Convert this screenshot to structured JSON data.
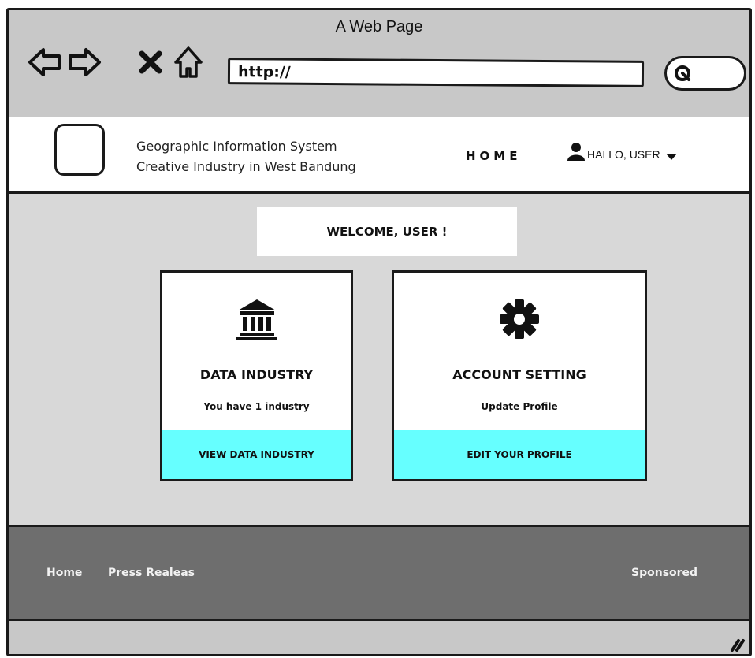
{
  "window": {
    "title": "A Web Page"
  },
  "browser": {
    "icons": [
      "back-arrow-icon",
      "forward-arrow-icon",
      "close-x-icon",
      "home-icon",
      "search-icon"
    ],
    "url": "http://"
  },
  "header": {
    "title_line1": "Geographic Information System",
    "title_line2": "Creative Industry in West Bandung",
    "nav_home": "HOME",
    "user_label": "HALLO, USER"
  },
  "main": {
    "welcome": "WELCOME, USER !",
    "cards": [
      {
        "icon": "bank-building-icon",
        "title": "DATA INDUSTRY",
        "subtitle": "You have 1 industry",
        "action": "VIEW DATA INDUSTRY"
      },
      {
        "icon": "gear-icon",
        "title": "ACCOUNT SETTING",
        "subtitle": "Update Profile",
        "action": "EDIT YOUR PROFILE"
      }
    ]
  },
  "footer": {
    "links": [
      "Home",
      "Press Realeas"
    ],
    "right_link": "Sponsored"
  },
  "colors": {
    "action_bg": "#66ffff",
    "footer_bg": "#6e6e6e",
    "chrome_bg": "#c8c8c8",
    "content_bg": "#d8d8d8"
  }
}
